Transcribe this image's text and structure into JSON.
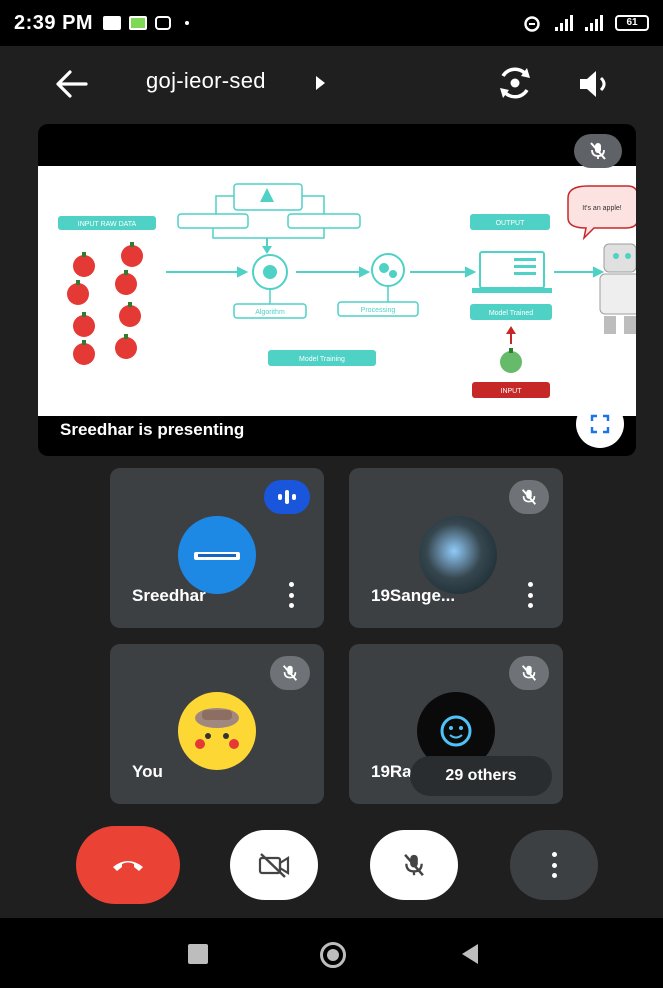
{
  "status_bar": {
    "time": "2:39 PM",
    "battery": "61"
  },
  "header": {
    "meeting_code": "goj-ieor-sed",
    "icons": [
      "back-arrow-icon",
      "switch-camera-icon",
      "speaker-icon"
    ]
  },
  "presentation": {
    "presenter_label": "Sreedhar is presenting",
    "mic_state": "muted",
    "slide": {
      "input_raw_data": "INPUT RAW DATA",
      "output": "OUTPUT",
      "model_trained": "Model Trained",
      "model_training": "Model Training",
      "algorithm": "Algorithm",
      "processing": "Processing",
      "input": "INPUT",
      "robot_speech": "It's an apple!"
    }
  },
  "participants": [
    {
      "name": "Sreedhar",
      "speaking": true,
      "muted": false
    },
    {
      "name": "19Sange...",
      "speaking": false,
      "muted": true
    },
    {
      "name": "You",
      "speaking": false,
      "muted": true
    },
    {
      "name": "19Ra",
      "speaking": false,
      "muted": true
    }
  ],
  "others_pill": "29 others",
  "controls": [
    "end-call",
    "camera-off",
    "mic-off",
    "more-options"
  ],
  "colors": {
    "hangup": "#ea4335",
    "speaking": "#1a56db",
    "tile": "#3c4043",
    "teal": "#4fd1c5"
  }
}
